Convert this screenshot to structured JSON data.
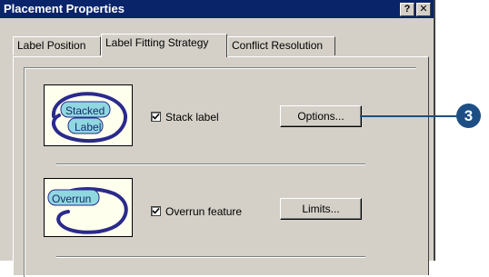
{
  "window": {
    "title": "Placement Properties",
    "help_glyph": "?",
    "close_glyph": "✕"
  },
  "tabs": [
    {
      "label": "Label Position"
    },
    {
      "label": "Label Fitting Strategy"
    },
    {
      "label": "Conflict Resolution"
    }
  ],
  "options": [
    {
      "preview_lines": [
        "Stacked",
        "Label"
      ],
      "checkbox_label": "Stack label",
      "checked": true,
      "button_label": "Options..."
    },
    {
      "preview_lines": [
        "Overrun"
      ],
      "checkbox_label": "Overrun feature",
      "checked": true,
      "button_label": "Limits..."
    }
  ],
  "callout": {
    "number": "3"
  },
  "colors": {
    "titlebar": "#0a246a",
    "ellipse_stroke": "#2a2a8c",
    "label_fill": "#8fd8e0",
    "callout": "#1d4f84"
  }
}
